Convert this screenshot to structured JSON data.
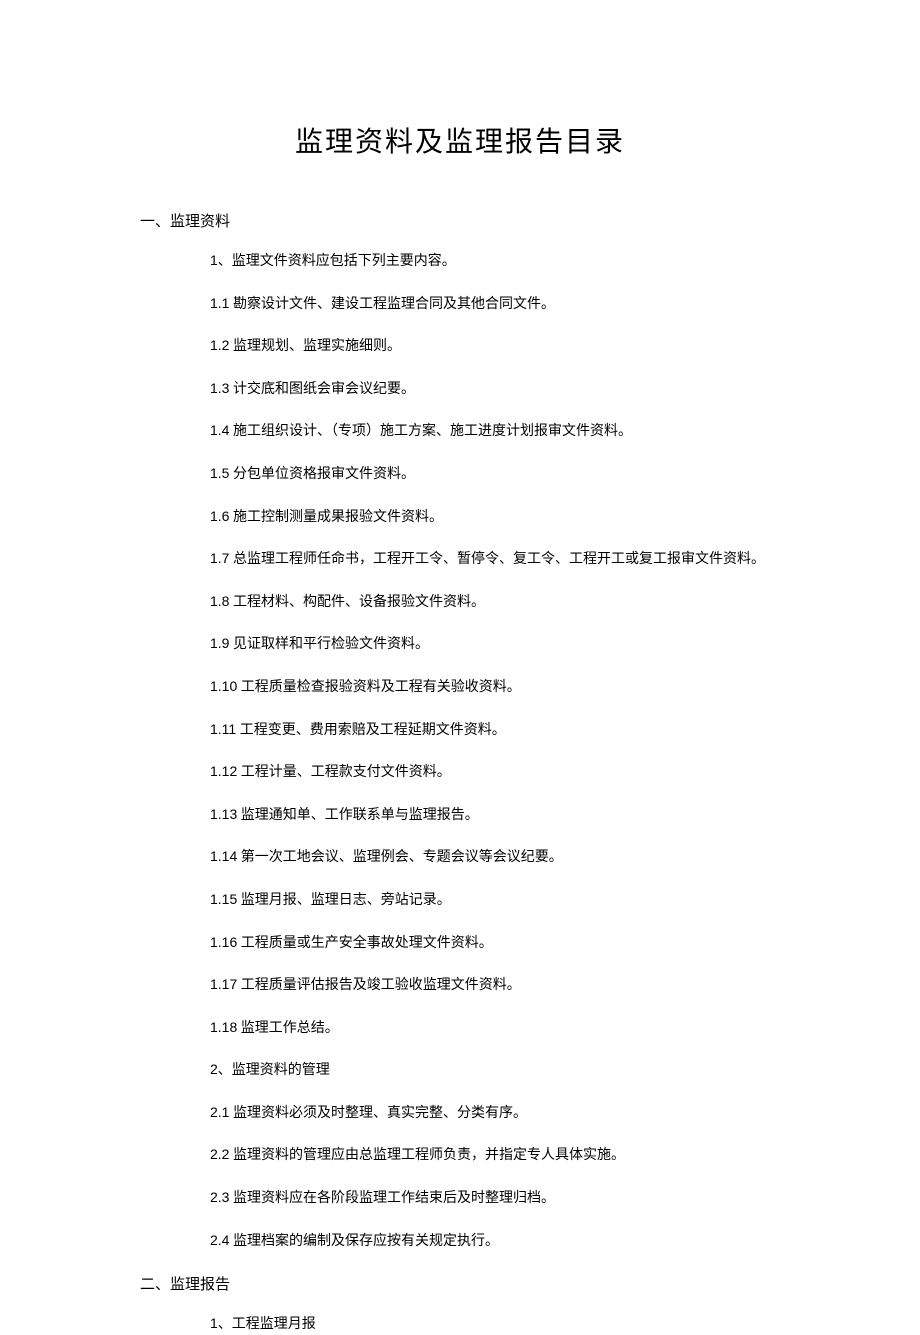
{
  "title": "监理资料及监理报告目录",
  "sections": [
    {
      "heading": "一、监理资料",
      "items": [
        {
          "num": "1、",
          "text": "监理文件资料应包括下列主要内容。"
        },
        {
          "num": "1.1",
          "text": "  勘察设计文件、建设工程监理合同及其他合同文件。"
        },
        {
          "num": "1.2",
          "text": "  监理规划、监理实施细则。"
        },
        {
          "num": "1.3",
          "text": "      计交底和图纸会审会议纪要。"
        },
        {
          "num": "1.4",
          "text": "  施工组织设计、（专项）施工方案、施工进度计划报审文件资料。"
        },
        {
          "num": "1.5",
          "text": "  分包单位资格报审文件资料。"
        },
        {
          "num": "1.6",
          "text": "  施工控制测量成果报验文件资料。"
        },
        {
          "num": "1.7",
          "text": "  总监理工程师任命书，工程开工令、暂停令、复工令、工程开工或复工报审文件资料。"
        },
        {
          "num": "1.8",
          "text": "  工程材料、构配件、设备报验文件资料。"
        },
        {
          "num": "1.9",
          "text": "  见证取样和平行检验文件资料。"
        },
        {
          "num": "1.10",
          "text": "  工程质量检查报验资料及工程有关验收资料。"
        },
        {
          "num": "1.11",
          "text": "  工程变更、费用索赔及工程延期文件资料。"
        },
        {
          "num": "1.12",
          "text": "  工程计量、工程款支付文件资料。"
        },
        {
          "num": "1.13",
          "text": "  监理通知单、工作联系单与监理报告。"
        },
        {
          "num": "1.14",
          "text": "  第一次工地会议、监理例会、专题会议等会议纪要。"
        },
        {
          "num": "1.15",
          "text": "  监理月报、监理日志、旁站记录。"
        },
        {
          "num": "1.16",
          "text": "  工程质量或生产安全事故处理文件资料。"
        },
        {
          "num": "1.17",
          "text": "  工程质量评估报告及竣工验收监理文件资料。"
        },
        {
          "num": "1.18",
          "text": "  监理工作总结。"
        },
        {
          "num": "2、",
          "text": "监理资料的管理"
        },
        {
          "num": "2.1",
          "text": "  监理资料必须及时整理、真实完整、分类有序。"
        },
        {
          "num": "2.2",
          "text": "  监理资料的管理应由总监理工程师负责，并指定专人具体实施。"
        },
        {
          "num": "2.3",
          "text": "  监理资料应在各阶段监理工作结束后及时整理归档。"
        },
        {
          "num": "2.4",
          "text": "  监理档案的编制及保存应按有关规定执行。"
        }
      ]
    },
    {
      "heading": "二、监理报告",
      "items": [
        {
          "num": "1、",
          "text": "工程监理月报"
        }
      ]
    }
  ]
}
